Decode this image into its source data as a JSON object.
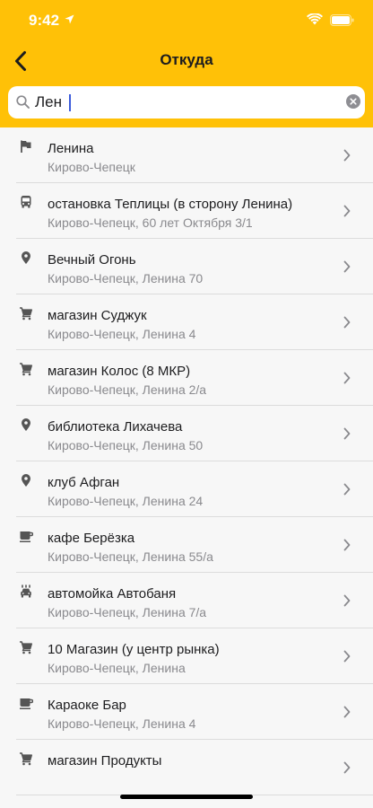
{
  "status_bar": {
    "time": "9:42"
  },
  "nav": {
    "title": "Откуда"
  },
  "search": {
    "value": "Лен",
    "placeholder": ""
  },
  "items": [
    {
      "icon": "flag-icon",
      "name": "Ленина",
      "address": "Кирово-Чепецк"
    },
    {
      "icon": "bus-icon",
      "name": "остановка Теплицы (в сторону Ленина)",
      "address": "Кирово-Чепецк, 60 лет Октября 3/1"
    },
    {
      "icon": "location-pin-icon",
      "name": "Вечный Огонь",
      "address": "Кирово-Чепецк, Ленина 70"
    },
    {
      "icon": "cart-icon",
      "name": "магазин Суджук",
      "address": "Кирово-Чепецк, Ленина 4"
    },
    {
      "icon": "cart-icon",
      "name": "магазин Колос (8 МКР)",
      "address": "Кирово-Чепецк, Ленина 2/а"
    },
    {
      "icon": "location-pin-icon",
      "name": "библиотека Лихачева",
      "address": "Кирово-Чепецк, Ленина 50"
    },
    {
      "icon": "location-pin-icon",
      "name": "клуб Афган",
      "address": "Кирово-Чепецк, Ленина 24"
    },
    {
      "icon": "coffee-icon",
      "name": "кафе Берёзка",
      "address": "Кирово-Чепецк, Ленина 55/а"
    },
    {
      "icon": "car-wash-icon",
      "name": "автомойка Автобаня",
      "address": "Кирово-Чепецк, Ленина 7/а"
    },
    {
      "icon": "cart-icon",
      "name": "10 Магазин (у центр рынка)",
      "address": "Кирово-Чепецк, Ленина"
    },
    {
      "icon": "coffee-icon",
      "name": "Караоке Бар",
      "address": "Кирово-Чепецк, Ленина 4"
    },
    {
      "icon": "cart-icon",
      "name": "магазин Продукты",
      "address": ""
    }
  ]
}
